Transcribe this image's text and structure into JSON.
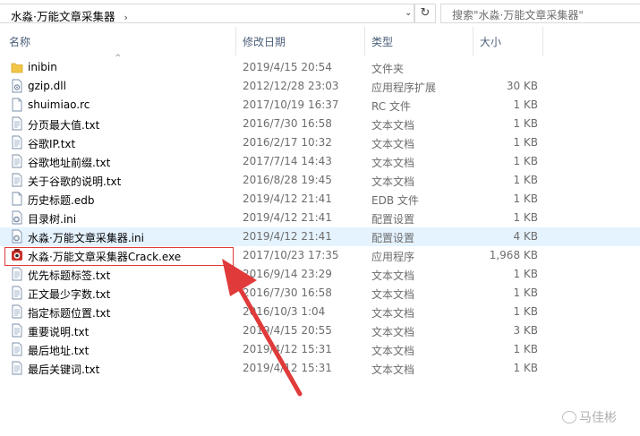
{
  "address": {
    "breadcrumb": "水淼·万能文章采集器",
    "sep": "›",
    "dropdown": "⌄",
    "refresh": "↻"
  },
  "search": {
    "placeholder": "搜索\"水淼·万能文章采集器\""
  },
  "columns": {
    "name": "名称",
    "date": "修改日期",
    "type": "类型",
    "size": "大小",
    "sort_indicator": "^"
  },
  "files": [
    {
      "name": "inibin",
      "date": "2019/4/15 20:54",
      "type": "文件夹",
      "size": "",
      "icon": "folder-icon"
    },
    {
      "name": "gzip.dll",
      "date": "2012/12/28 23:03",
      "type": "应用程序扩展",
      "size": "30 KB",
      "icon": "dll-file-icon"
    },
    {
      "name": "shuimiao.rc",
      "date": "2017/10/19 16:37",
      "type": "RC 文件",
      "size": "1 KB",
      "icon": "file-icon"
    },
    {
      "name": "分页最大值.txt",
      "date": "2016/7/30 16:58",
      "type": "文本文档",
      "size": "1 KB",
      "icon": "text-file-icon"
    },
    {
      "name": "谷歌IP.txt",
      "date": "2016/2/17 10:32",
      "type": "文本文档",
      "size": "1 KB",
      "icon": "text-file-icon"
    },
    {
      "name": "谷歌地址前缀.txt",
      "date": "2017/7/14 14:43",
      "type": "文本文档",
      "size": "1 KB",
      "icon": "text-file-icon"
    },
    {
      "name": "关于谷歌的说明.txt",
      "date": "2016/8/28 19:45",
      "type": "文本文档",
      "size": "1 KB",
      "icon": "text-file-icon"
    },
    {
      "name": "历史标题.edb",
      "date": "2019/4/12 21:41",
      "type": "EDB 文件",
      "size": "1 KB",
      "icon": "file-icon"
    },
    {
      "name": "目录树.ini",
      "date": "2019/4/12 21:41",
      "type": "配置设置",
      "size": "1 KB",
      "icon": "ini-file-icon"
    },
    {
      "name": "水淼·万能文章采集器.ini",
      "date": "2019/4/12 21:41",
      "type": "配置设置",
      "size": "4 KB",
      "icon": "ini-file-icon",
      "selected": true
    },
    {
      "name": "水淼·万能文章采集器Crack.exe",
      "date": "2017/10/23 17:35",
      "type": "应用程序",
      "size": "1,968 KB",
      "icon": "exe-app-icon"
    },
    {
      "name": "优先标题标签.txt",
      "date": "2016/9/14 23:29",
      "type": "文本文档",
      "size": "1 KB",
      "icon": "text-file-icon"
    },
    {
      "name": "正文最少字数.txt",
      "date": "2016/7/30 16:58",
      "type": "文本文档",
      "size": "1 KB",
      "icon": "text-file-icon"
    },
    {
      "name": "指定标题位置.txt",
      "date": "2016/10/3 1:04",
      "type": "文本文档",
      "size": "1 KB",
      "icon": "text-file-icon"
    },
    {
      "name": "重要说明.txt",
      "date": "2019/4/15 20:55",
      "type": "文本文档",
      "size": "3 KB",
      "icon": "text-file-icon"
    },
    {
      "name": "最后地址.txt",
      "date": "2019/4/12 15:31",
      "type": "文本文档",
      "size": "1 KB",
      "icon": "text-file-icon"
    },
    {
      "name": "最后关键词.txt",
      "date": "2019/4/12 15:31",
      "type": "文本文档",
      "size": "1 KB",
      "icon": "text-file-icon"
    }
  ],
  "watermark": {
    "text": "马佳彬"
  },
  "colors": {
    "highlight_box": "#e03a3a",
    "arrow": "#e03a3a",
    "selection": "#e5f3ff",
    "folder": "#f3c649"
  }
}
